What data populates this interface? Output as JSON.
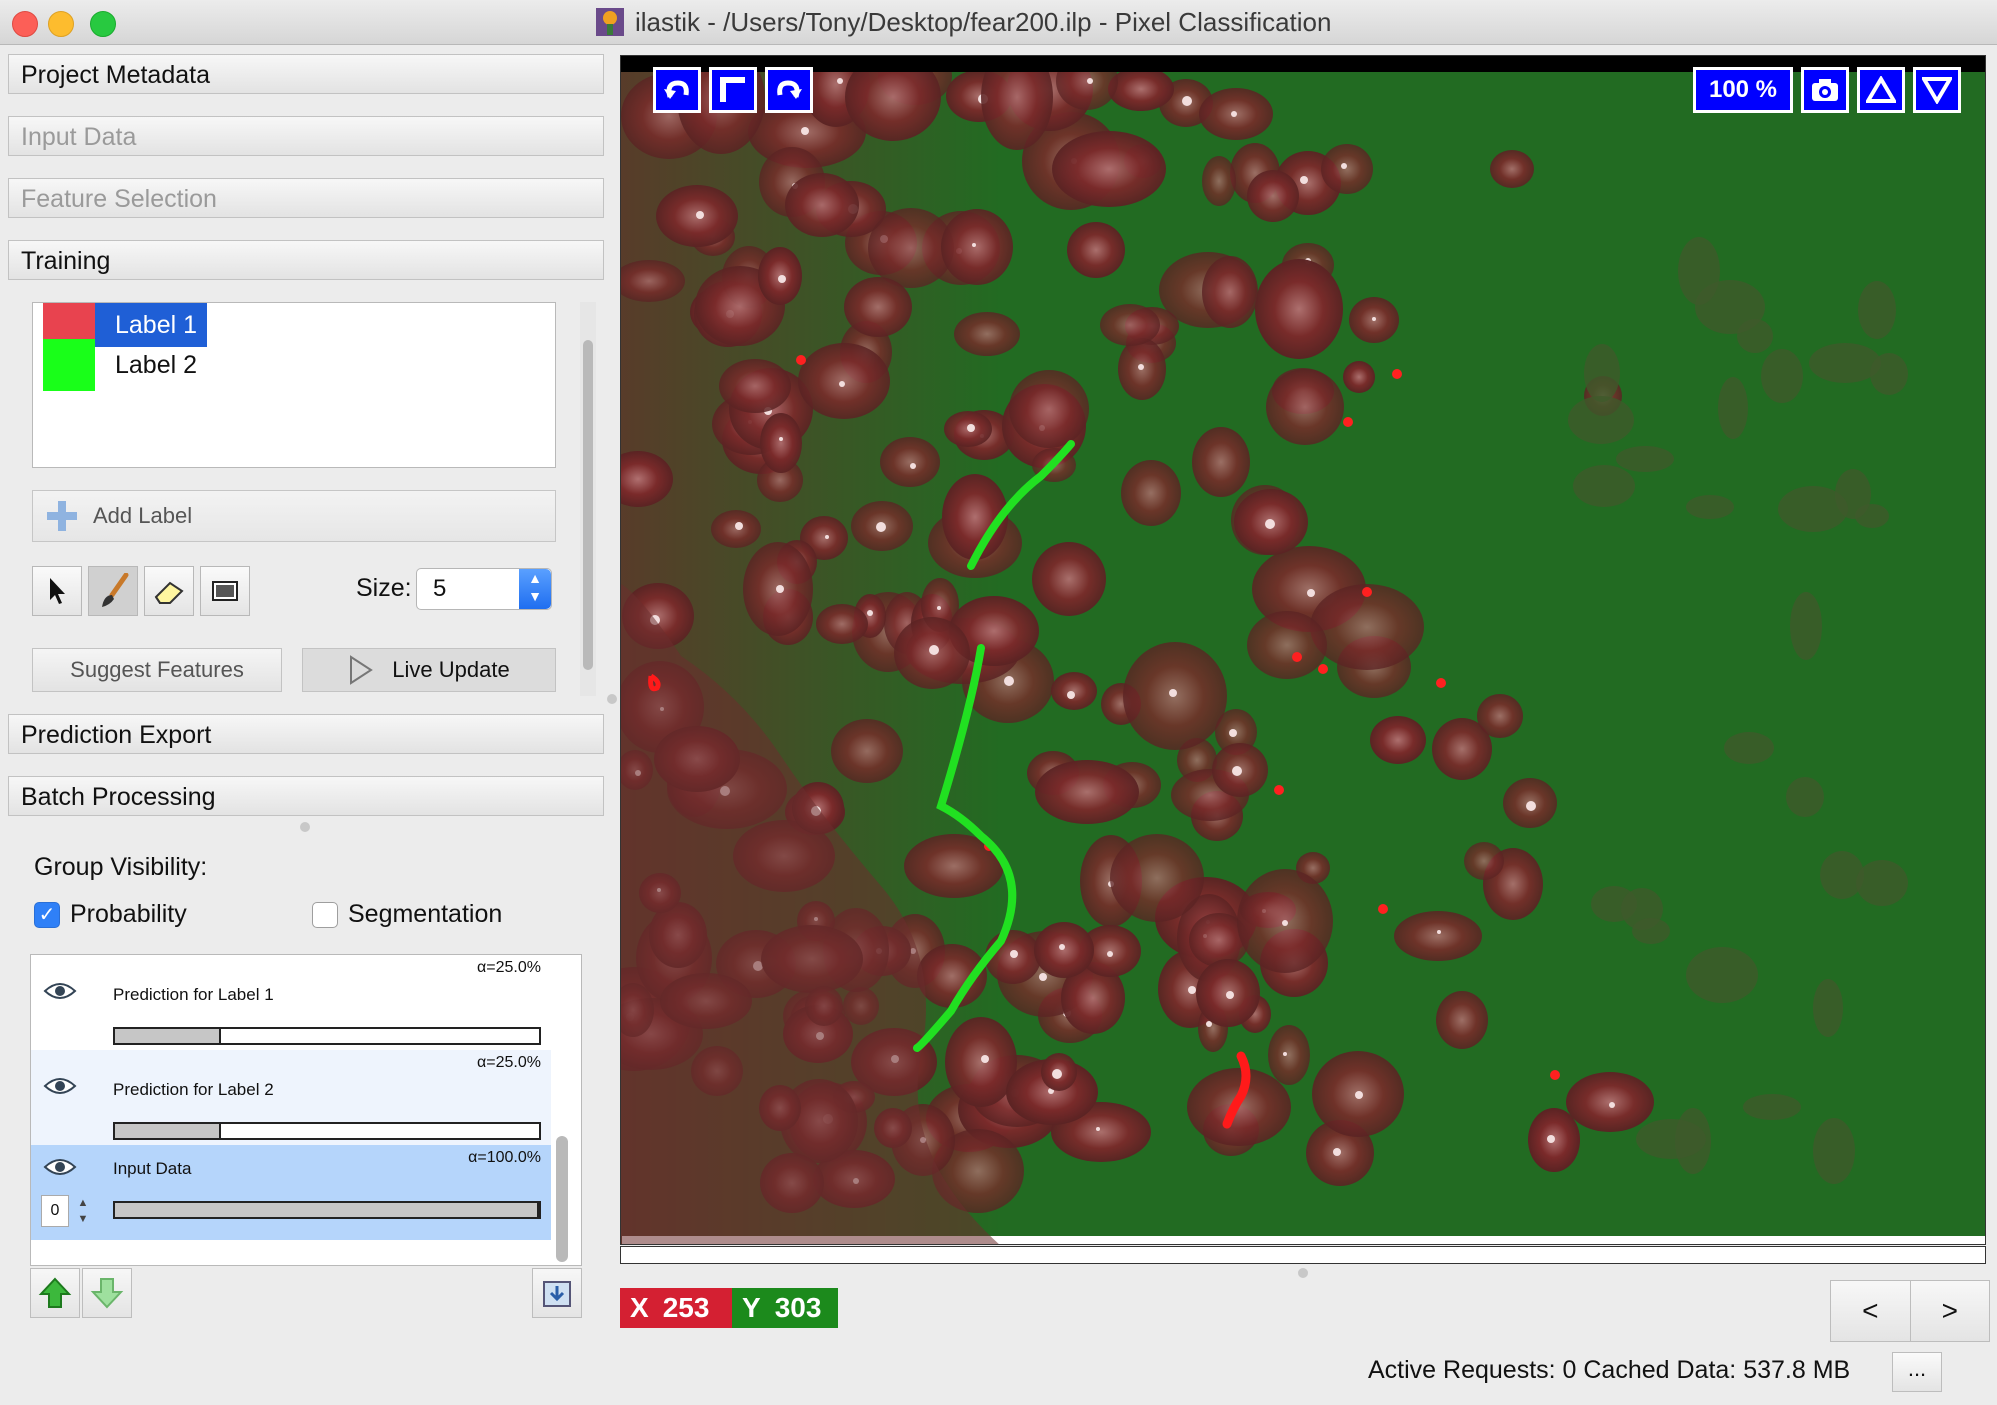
{
  "window": {
    "title": "ilastik - /Users/Tony/Desktop/fear200.ilp - Pixel Classification"
  },
  "applets": {
    "project_metadata": "Project Metadata",
    "input_data": "Input Data",
    "feature_selection": "Feature Selection",
    "training": "Training",
    "prediction_export": "Prediction Export",
    "batch_processing": "Batch Processing"
  },
  "training": {
    "labels": [
      {
        "name": "Label 1",
        "color": "#e8434f",
        "selected": true
      },
      {
        "name": "Label 2",
        "color": "#19ff19",
        "selected": false
      }
    ],
    "add_label": "Add Label",
    "size_label": "Size:",
    "size_value": "5",
    "suggest_features": "Suggest Features",
    "live_update": "Live Update",
    "tools": [
      "pointer-icon",
      "brush-icon",
      "eraser-icon",
      "threshold-icon"
    ]
  },
  "group_visibility": {
    "title": "Group Visibility:",
    "probability": "Probability",
    "probability_checked": true,
    "segmentation": "Segmentation",
    "segmentation_checked": false
  },
  "layers": [
    {
      "name": "Prediction for Label 1",
      "alpha": "α=25.0%",
      "opacity": 0.25
    },
    {
      "name": "Prediction for Label 2",
      "alpha": "α=25.0%",
      "opacity": 0.25
    },
    {
      "name": "Input Data",
      "alpha": "α=100.0%",
      "opacity": 1.0,
      "channel": "0"
    }
  ],
  "viewer": {
    "zoom": "100 %",
    "x_label": "X",
    "x_value": "253",
    "y_label": "Y",
    "y_value": "303",
    "x_color": "#d42032",
    "y_color": "#1c8a1c"
  },
  "nav": {
    "prev": "<",
    "next": ">"
  },
  "status": {
    "text": "Active Requests: 0  Cached Data: 537.8 MB",
    "more": "..."
  }
}
